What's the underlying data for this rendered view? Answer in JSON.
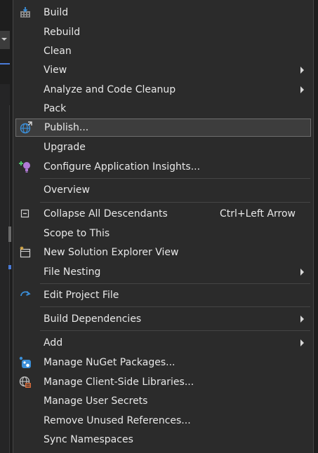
{
  "menu": {
    "items": [
      {
        "label": "Build",
        "icon": "build-icon"
      },
      {
        "label": "Rebuild"
      },
      {
        "label": "Clean"
      },
      {
        "label": "View",
        "submenu": true
      },
      {
        "label": "Analyze and Code Cleanup",
        "submenu": true
      },
      {
        "label": "Pack"
      },
      {
        "label": "Publish...",
        "icon": "publish-globe-icon",
        "selected": true
      },
      {
        "label": "Upgrade"
      },
      {
        "label": "Configure Application Insights...",
        "icon": "application-insights-icon"
      },
      {
        "label": "Overview"
      },
      {
        "label": "Collapse All Descendants",
        "icon": "collapse-all-icon",
        "shortcut": "Ctrl+Left Arrow"
      },
      {
        "label": "Scope to This"
      },
      {
        "label": "New Solution Explorer View",
        "icon": "new-solution-explorer-view-icon"
      },
      {
        "label": "File Nesting",
        "submenu": true
      },
      {
        "label": "Edit Project File",
        "icon": "edit-project-file-icon"
      },
      {
        "label": "Build Dependencies",
        "submenu": true
      },
      {
        "label": "Add",
        "submenu": true
      },
      {
        "label": "Manage NuGet Packages...",
        "icon": "nuget-icon"
      },
      {
        "label": "Manage Client-Side Libraries...",
        "icon": "client-side-libraries-icon"
      },
      {
        "label": "Manage User Secrets"
      },
      {
        "label": "Remove Unused References..."
      },
      {
        "label": "Sync Namespaces"
      }
    ]
  },
  "colors": {
    "menu_background": "#2b2b2b",
    "text": "#e8e8e8",
    "selection_background": "#3d3d3d",
    "selection_border": "#6e6e6e",
    "separator": "#454545"
  }
}
